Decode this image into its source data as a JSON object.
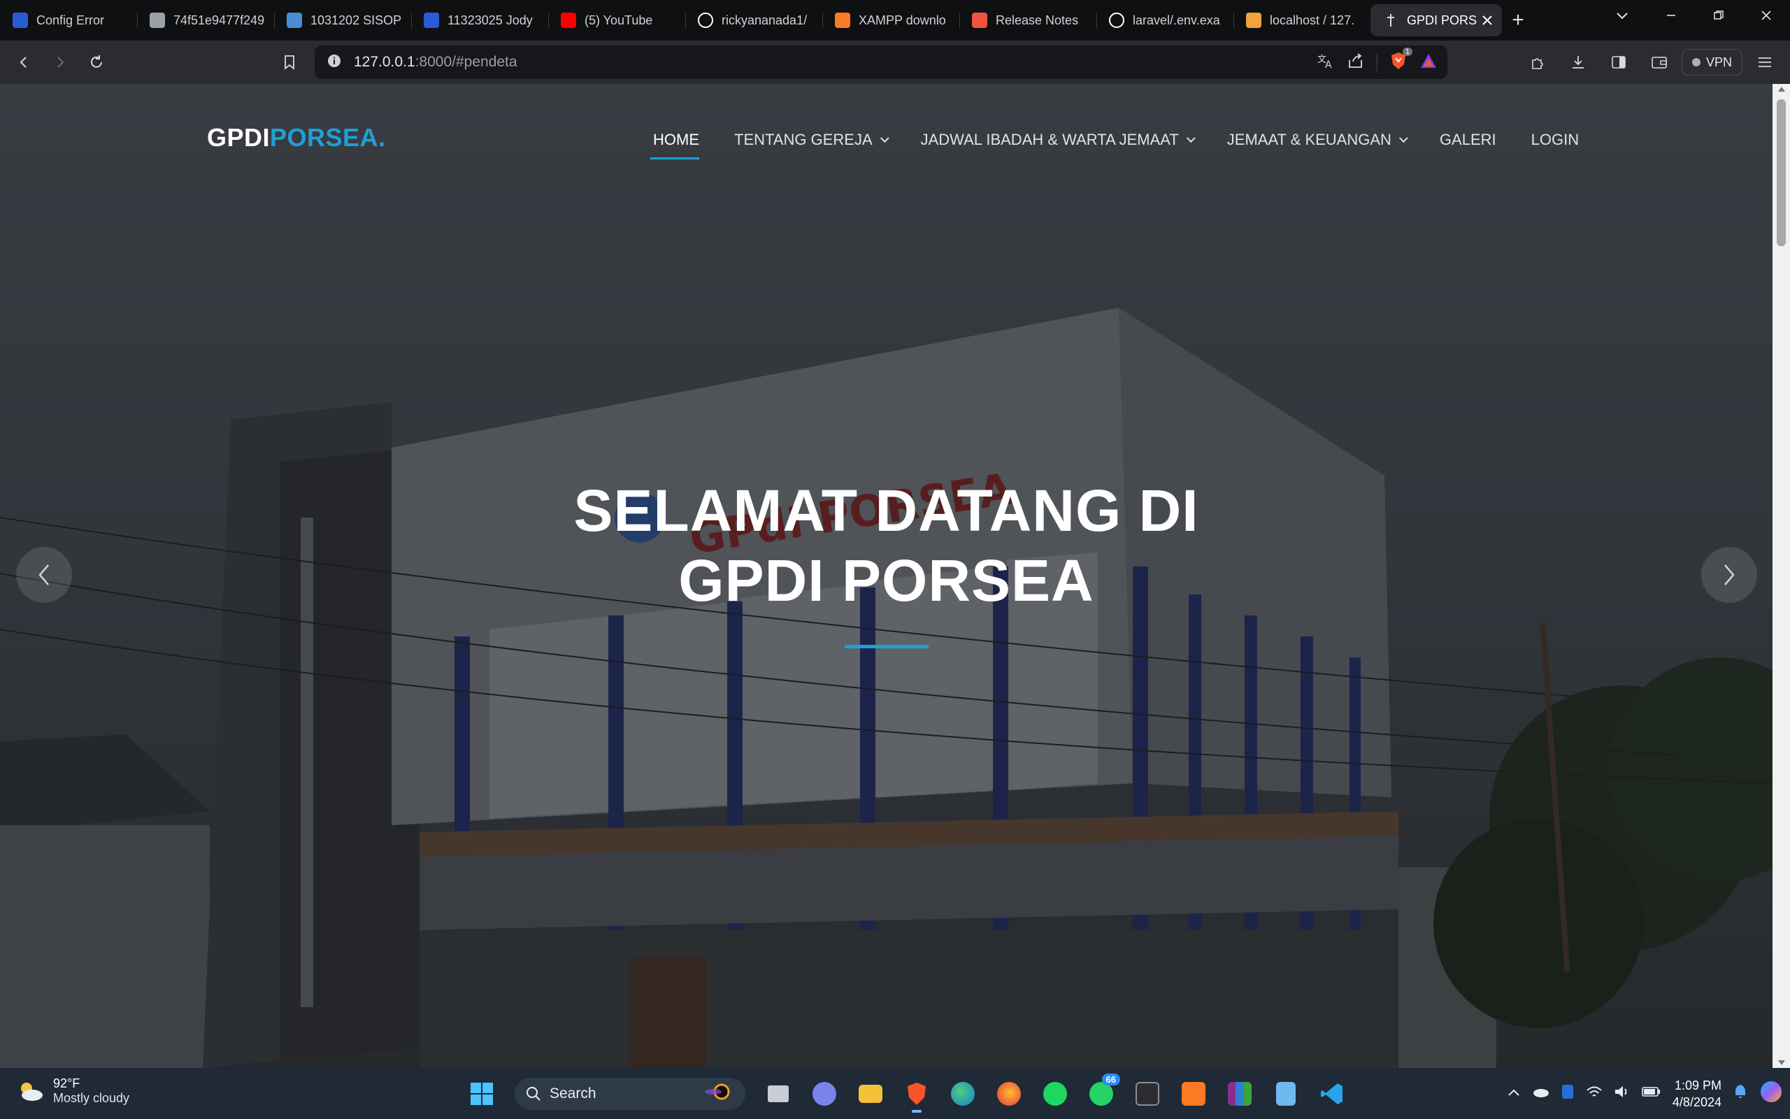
{
  "browser": {
    "tabs": [
      {
        "title": "Config Error",
        "icon": "del-favicon-icon",
        "color": "#2a5bd7"
      },
      {
        "title": "74f51e9477f249",
        "icon": "globe-icon",
        "color": "#9aa0a6"
      },
      {
        "title": "1031202 SISOP",
        "icon": "doc-favicon-icon",
        "color": "#4a8bd6"
      },
      {
        "title": "11323025 Jody",
        "icon": "del-favicon-icon",
        "color": "#2a5bd7"
      },
      {
        "title": "(5) YouTube",
        "icon": "youtube-icon",
        "color": "#ff0000"
      },
      {
        "title": "rickyananada1/",
        "icon": "github-icon",
        "color": "#ffffff"
      },
      {
        "title": "XAMPP downlo",
        "icon": "xampp-icon",
        "color": "#fb7a24"
      },
      {
        "title": "Release Notes",
        "icon": "laravel-icon",
        "color": "#f05340"
      },
      {
        "title": "laravel/.env.exa",
        "icon": "github-icon",
        "color": "#ffffff"
      },
      {
        "title": "localhost / 127.",
        "icon": "phpmyadmin-icon",
        "color": "#f2a33a"
      },
      {
        "title": "GPDI PORS",
        "icon": "cross-icon",
        "color": "#dddddd",
        "active": true
      }
    ],
    "new_tab": "+",
    "url_host": "127.0.0.1",
    "url_path": ":8000/#pendeta",
    "vpn_label": "VPN",
    "shield_badge": "1"
  },
  "site": {
    "logo_part1": "GPDI",
    "logo_part2": "PORSEA.",
    "nav": [
      {
        "label": "HOME",
        "active": true,
        "dropdown": false
      },
      {
        "label": "TENTANG GEREJA",
        "dropdown": true
      },
      {
        "label": "JADWAL IBADAH & WARTA JEMAAT",
        "dropdown": true
      },
      {
        "label": "JEMAAT & KEUANGAN",
        "dropdown": true
      },
      {
        "label": "GALERI",
        "dropdown": false
      },
      {
        "label": "LOGIN",
        "dropdown": false
      }
    ],
    "hero_line1": "SELAMAT DATANG DI",
    "hero_line2": "GPDI PORSEA",
    "building_sign": "GPdI PORSEA",
    "accent_color": "#1ea0d6"
  },
  "taskbar": {
    "temperature": "92°F",
    "condition": "Mostly cloudy",
    "search_label": "Search",
    "whatsapp_badge": "66",
    "time": "1:09 PM",
    "date": "4/8/2024"
  }
}
